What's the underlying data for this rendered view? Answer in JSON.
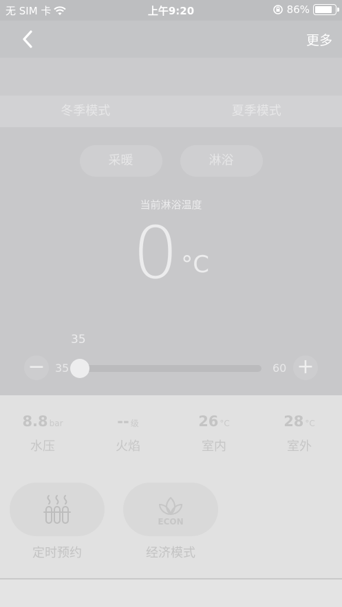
{
  "status_bar": {
    "carrier": "无 SIM 卡",
    "time": "上午9:20",
    "battery": "86%",
    "battery_level": 0.86
  },
  "nav": {
    "more": "更多"
  },
  "season_tabs": [
    "冬季模式",
    "夏季模式"
  ],
  "modes": [
    "采暖",
    "淋浴"
  ],
  "temperature": {
    "label": "当前淋浴温度",
    "value": "0",
    "unit": "°C"
  },
  "slider": {
    "current": "35",
    "min": "35",
    "max": "60",
    "minus": "−",
    "plus": "+"
  },
  "stats": [
    {
      "value": "8.8",
      "unit": "bar",
      "name": "水压"
    },
    {
      "value": "--",
      "unit": "级",
      "name": "火焰"
    },
    {
      "value": "26",
      "unit": "°C",
      "name": "室内"
    },
    {
      "value": "28",
      "unit": "°C",
      "name": "室外"
    }
  ],
  "features": [
    {
      "name": "定时预约",
      "icon": "heating-rods-icon"
    },
    {
      "name": "经济模式",
      "icon": "econ-leaf-icon",
      "icon_text": "ECON"
    }
  ],
  "colors": {
    "overlay": "#c8c8ca",
    "panel": "#e1e1e1"
  }
}
